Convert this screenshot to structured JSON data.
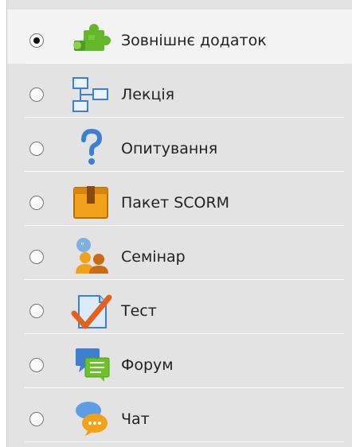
{
  "activities": [
    {
      "label": "Зовнішнє додаток",
      "icon": "puzzle-icon",
      "selected": true
    },
    {
      "label": "Лекція",
      "icon": "lesson-flowchart-icon",
      "selected": false
    },
    {
      "label": "Опитування",
      "icon": "question-mark-icon",
      "selected": false
    },
    {
      "label": "Пакет SCORM",
      "icon": "scorm-package-icon",
      "selected": false
    },
    {
      "label": "Семінар",
      "icon": "workshop-people-icon",
      "selected": false
    },
    {
      "label": "Тест",
      "icon": "quiz-checkmark-icon",
      "selected": false
    },
    {
      "label": "Форум",
      "icon": "forum-speech-bubbles-icon",
      "selected": false
    },
    {
      "label": "Чат",
      "icon": "chat-bubble-icon",
      "selected": false
    }
  ],
  "colors": {
    "panel_bg": "#e3e3e3",
    "selected_bg": "#f3f3f3",
    "green": "#59b51c",
    "blue": "#3d7fd1",
    "orange": "#f2a11b"
  }
}
